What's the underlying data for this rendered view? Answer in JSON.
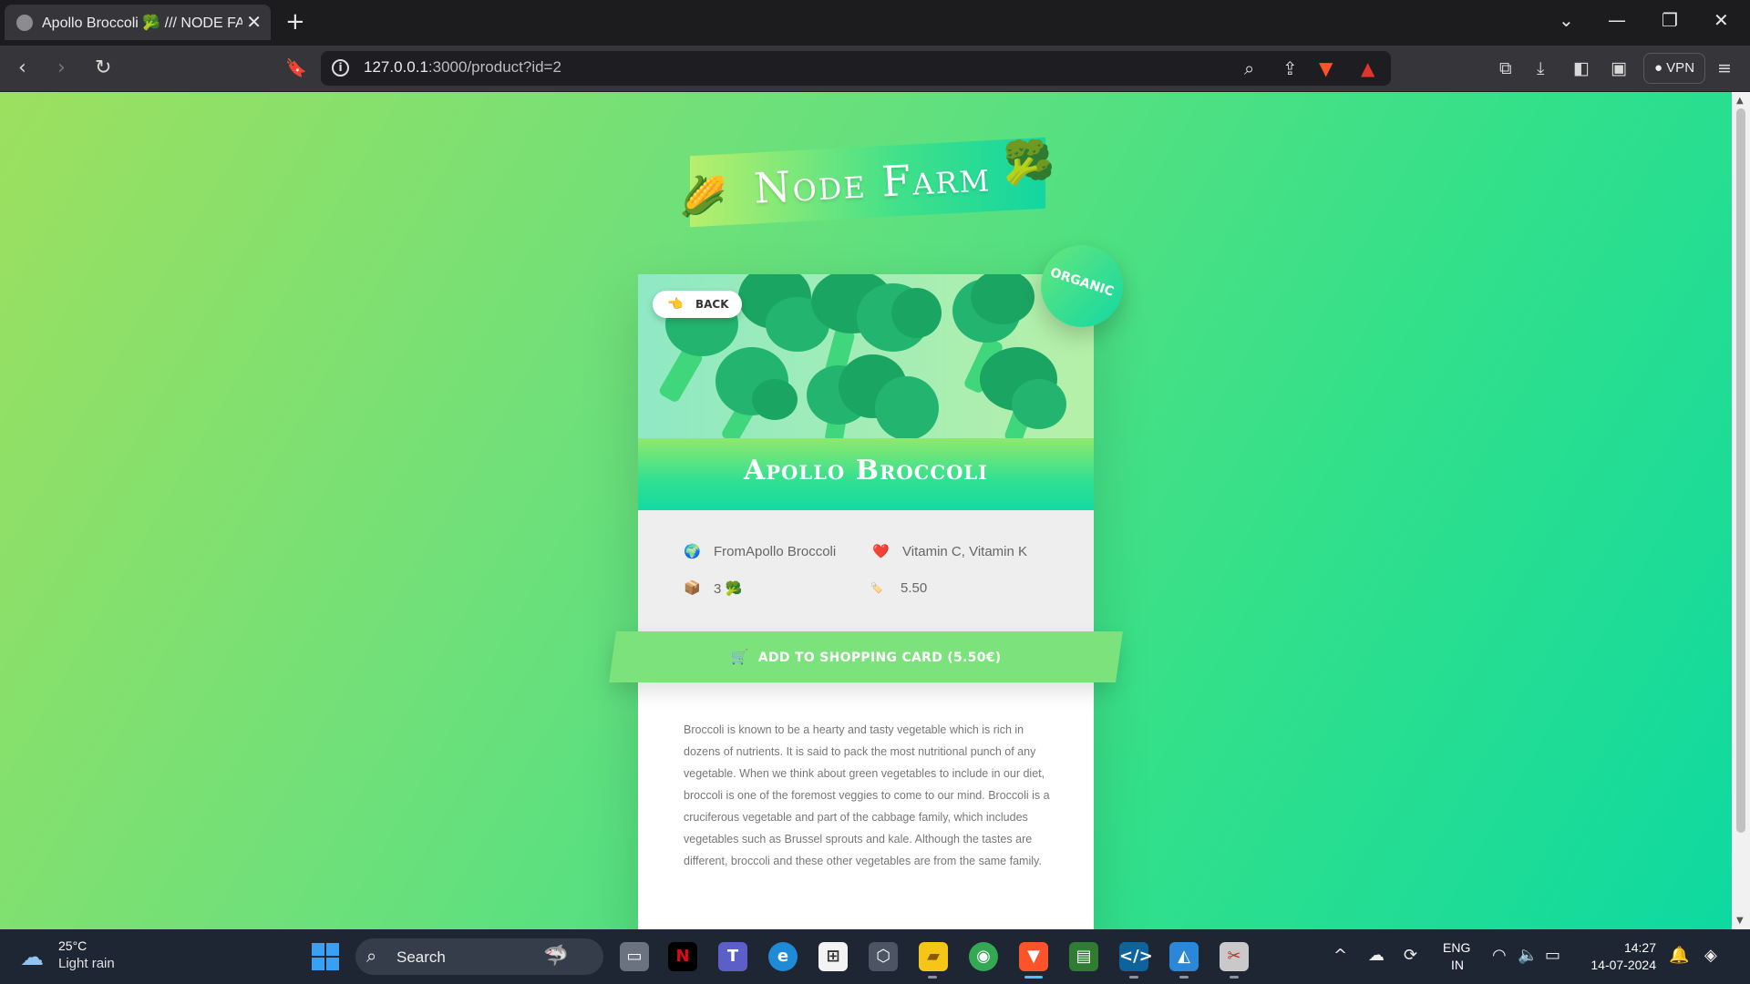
{
  "browser": {
    "tab_title": "Apollo Broccoli 🥦 /// NODE FARM",
    "new_tab": "+",
    "close_tab": "✕",
    "url_host": "127.0.0.1",
    "url_rest": ":3000/product?id=2",
    "vpn_label": "● VPN",
    "window_controls": {
      "minimize": "—",
      "restore": "❐",
      "close": "✕",
      "tab_list": "⌄"
    }
  },
  "page": {
    "logo_text": "Node Farm",
    "logo_emoji_left": "🌽",
    "logo_emoji_right": "🥦",
    "back": {
      "icon": "👈",
      "label": "BACK"
    },
    "organic_badge": "ORGANIC",
    "product_name": "Apollo Broccoli",
    "details": {
      "from_icon": "🌍",
      "from": "FromApollo Broccoli",
      "nutrients_icon": "❤️",
      "nutrients": "Vitamin C, Vitamin K",
      "quantity_icon": "📦",
      "quantity": "3 🥦",
      "price_icon": "🏷️",
      "price": "5.50"
    },
    "add_to_cart": {
      "icon": "🛒",
      "label": "ADD TO SHOPPING CARD (5.50€)"
    },
    "description": "Broccoli is known to be a hearty and tasty vegetable which is rich in dozens of nutrients. It is said to pack the most nutritional punch of any vegetable. When we think about green vegetables to include in our diet, broccoli is one of the foremost veggies to come to our mind. Broccoli is a cruciferous vegetable and part of the cabbage family, which includes vegetables such as Brussel sprouts and kale. Although the tastes are different, broccoli and these other vegetables are from the same family."
  },
  "taskbar": {
    "weather_temp": "25°C",
    "weather_cond": "Light rain",
    "search_label": "Search",
    "lang_top": "ENG",
    "lang_bottom": "IN",
    "time": "14:27",
    "date": "14-07-2024"
  },
  "colors": {
    "bg_gradient_start": "#9de05f",
    "bg_gradient_end": "#0ed9a0",
    "accent_green": "#7ce27b",
    "taskbar": "#1f2633"
  }
}
